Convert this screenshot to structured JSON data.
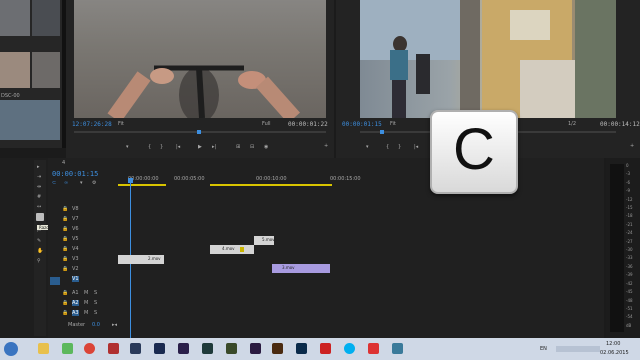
{
  "source_monitor": {
    "timecode_in": "12:07:26:28",
    "fit_left": "Fit",
    "fit_right": "Full",
    "timecode_out": "00:00:01:22"
  },
  "program_monitor": {
    "timecode_in": "00:00:01:15",
    "fit_left": "Fit",
    "fit_right": "1/2",
    "timecode_out": "00:00:14:12"
  },
  "project_panel": {
    "clip_label": "DSC-00"
  },
  "timeline": {
    "tab_label": "4",
    "playhead_timecode": "00:00:01:15",
    "ruler_labels": [
      "00:00:00:00",
      "00:00:05:00",
      "00:00:10:00",
      "00:00:15:00"
    ],
    "tooltip": "Razor Tool (C)",
    "video_tracks": [
      "V8",
      "V7",
      "V6",
      "V5",
      "V4",
      "V3",
      "V2",
      "V1"
    ],
    "audio_tracks": [
      "A1",
      "A2",
      "A3"
    ],
    "master_label": "Master",
    "master_value": "0.0",
    "clips": [
      "2.mov",
      "4.mov",
      "5.mov",
      "3.mov"
    ]
  },
  "key_overlay": {
    "key": "C"
  },
  "audio_meter": {
    "scale": [
      "0",
      "-3",
      "-6",
      "-9",
      "-12",
      "-15",
      "-18",
      "-21",
      "-24",
      "-27",
      "-30",
      "-33",
      "-36",
      "-39",
      "-42",
      "-45",
      "-48",
      "-51",
      "-54",
      "dB"
    ]
  },
  "taskbar": {
    "language": "EN",
    "time": "12:00",
    "date": "02.06.2015"
  },
  "colors": {
    "accent_blue": "#3d8fe0",
    "clip_purple": "#a89be0",
    "work_area_yellow": "#d8c400"
  }
}
